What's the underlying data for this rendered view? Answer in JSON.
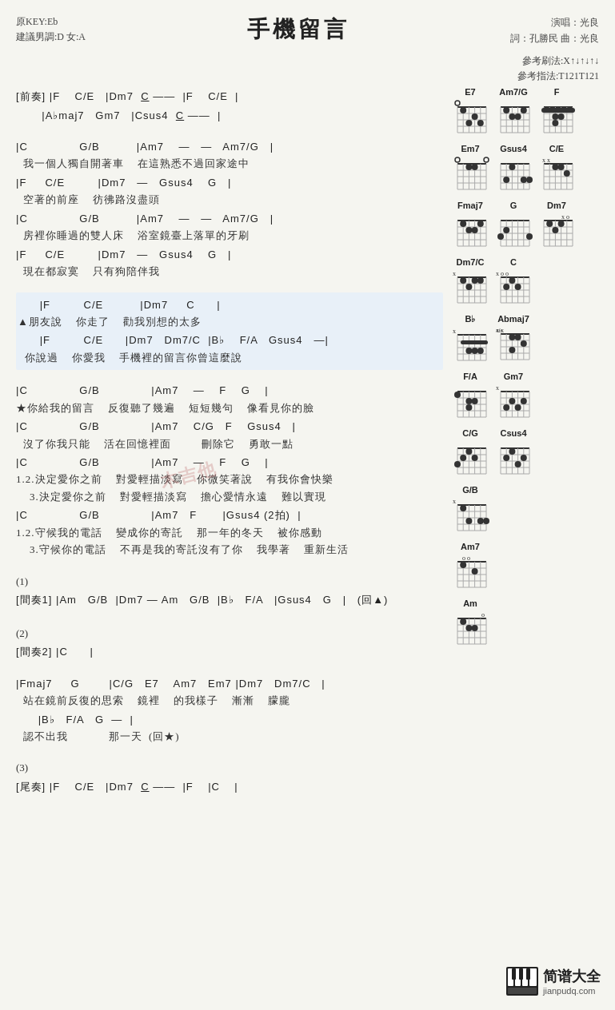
{
  "title": "手機留言",
  "header": {
    "key_info": "原KEY:Eb\n建議男調:D 女:A",
    "performer": "演唱：光良",
    "lyricist": "詞：孔勝民  曲：光良",
    "strum_pattern": "參考刷法:X↑↓↑↓↑↓",
    "finger_pattern": "參考指法:T121T121"
  },
  "sections": [
    {
      "id": "prelude",
      "label": "[前奏]",
      "lines": [
        {
          "type": "chord",
          "text": "[前奏] |F    C/E   |Dm7  <u>C</u> ——  |F    C/E  |"
        },
        {
          "type": "chord",
          "text": "      |A♭maj7   Gm7   |Csus4  <u>C</u> ——  |"
        }
      ]
    },
    {
      "id": "verse1",
      "lines": [
        {
          "type": "chord",
          "text": "|C              G/B          |Am7    —   —   Am7/G   |"
        },
        {
          "type": "lyric",
          "text": "  我一個人獨自開著車    在這熟悉不過回家途中"
        },
        {
          "type": "chord",
          "text": "|F     C/E         |Dm7   —   Gsus4    G   |"
        },
        {
          "type": "lyric",
          "text": "  空著的前座    彷彿路沒盡頭"
        },
        {
          "type": "chord",
          "text": "|C              G/B          |Am7    —   —   Am7/G   |"
        },
        {
          "type": "lyric",
          "text": "  房裡你睡過的雙人床    浴室鏡臺上落單的牙刷"
        },
        {
          "type": "chord",
          "text": "|F     C/E         |Dm7   —   Gsus4    G   |"
        },
        {
          "type": "lyric",
          "text": "  現在都寂寞    只有狗陪伴我"
        }
      ]
    },
    {
      "id": "bridge",
      "highlight": true,
      "lines": [
        {
          "type": "chord",
          "text": "      |F         C/E          |Dm7     C      |"
        },
        {
          "type": "lyric",
          "text": "▲朋友說    你走了    勸我別想的太多"
        },
        {
          "type": "chord",
          "text": "      |F         C/E      |Dm7   Dm7/C  |B♭    F/A   Gsus4   —|"
        },
        {
          "type": "lyric",
          "text": "  你說過    你愛我    手機裡的留言你曾這麼說"
        }
      ]
    },
    {
      "id": "chorus",
      "lines": [
        {
          "type": "chord",
          "text": "|C              G/B              |Am7    —    F    G    |"
        },
        {
          "type": "lyric",
          "text": "★你給我的留言    反復聽了幾遍    短短幾句    像看見你的臉"
        },
        {
          "type": "chord",
          "text": "|C              G/B              |Am7    C/G   F    Gsus4   |"
        },
        {
          "type": "lyric",
          "text": "  沒了你我只能    活在回憶裡面         刪除它    勇敢一點"
        },
        {
          "type": "chord",
          "text": "|C              G/B              |Am7    —    F    G    |"
        },
        {
          "type": "lyric",
          "text": "1.2.決定愛你之前    對愛輕描淡寫    你微笑著說    有我你會快樂"
        },
        {
          "type": "lyric",
          "text": "    3.決定愛你之前    對愛輕描淡寫    擔心愛情永遠    難以實現"
        },
        {
          "type": "chord",
          "text": "|C              G/B              |Am7   F       |Gsus4 (2拍)  |"
        },
        {
          "type": "lyric",
          "text": "1.2.守候我的電話    變成你的寄託    那一年的冬天    被你感動"
        },
        {
          "type": "lyric",
          "text": "    3.守候你的電話    不再是我的寄託沒有了你    我學著    重新生活"
        }
      ]
    },
    {
      "id": "interlude1_label",
      "lines": [
        {
          "type": "numbered",
          "text": "(1)"
        },
        {
          "type": "chord",
          "text": "[間奏1] |Am   G/B  |Dm7 — Am   G/B  |B♭   F/A   |Gsus4   G   |   (回▲)"
        }
      ]
    },
    {
      "id": "interlude2_label",
      "lines": [
        {
          "type": "numbered",
          "text": "(2)"
        },
        {
          "type": "chord",
          "text": "[間奏2] |C      |"
        }
      ]
    },
    {
      "id": "bridge2",
      "lines": [
        {
          "type": "chord",
          "text": "|Fmaj7     G        |C/G   E7    Am7   Em7 |Dm7   Dm7/C   |"
        },
        {
          "type": "lyric",
          "text": "  站在鏡前反復的思索    鏡裡    的我樣子    漸漸    朦朧"
        },
        {
          "type": "chord",
          "text": "      |B♭   F/A   G  —  |"
        },
        {
          "type": "lyric",
          "text": "  認不出我            那一天  (回★)"
        }
      ]
    },
    {
      "id": "outro_label",
      "lines": [
        {
          "type": "numbered",
          "text": "(3)"
        },
        {
          "type": "chord",
          "text": "[尾奏] |F    C/E   |Dm7  <u>C</u> ——  |F    |C    |"
        }
      ]
    }
  ],
  "chord_diagrams": [
    {
      "name": "E7",
      "markers": "x above 2nd",
      "frets": [
        [
          0,
          2,
          0,
          1,
          0,
          2
        ]
      ]
    },
    {
      "name": "Am7/G",
      "markers": "",
      "frets": []
    },
    {
      "name": "F",
      "markers": "barre",
      "frets": []
    },
    {
      "name": "Em7",
      "markers": "",
      "frets": []
    },
    {
      "name": "Gsus4",
      "markers": "",
      "frets": []
    },
    {
      "name": "C/E",
      "markers": "x x",
      "frets": []
    },
    {
      "name": "Fmaj7",
      "markers": "",
      "frets": []
    },
    {
      "name": "G",
      "markers": "",
      "frets": []
    },
    {
      "name": "Dm7",
      "markers": "x o",
      "frets": []
    },
    {
      "name": "Dm7/C",
      "markers": "x",
      "frets": []
    },
    {
      "name": "C",
      "markers": "x o o",
      "frets": []
    },
    {
      "name": "Bb",
      "markers": "x",
      "frets": []
    },
    {
      "name": "Abmaj7",
      "markers": "x x",
      "frets": []
    },
    {
      "name": "F/A",
      "markers": "",
      "frets": []
    },
    {
      "name": "Gm7",
      "markers": "x",
      "frets": []
    },
    {
      "name": "C/G",
      "markers": "",
      "frets": []
    },
    {
      "name": "Csus4",
      "markers": "",
      "frets": []
    },
    {
      "name": "G/B",
      "markers": "x",
      "frets": []
    },
    {
      "name": "Am7",
      "markers": "o o",
      "frets": []
    },
    {
      "name": "Am",
      "markers": "o",
      "frets": []
    }
  ],
  "watermark": "木吉他",
  "logo_text": "简谱大全",
  "logo_url": "jianpudq.com"
}
